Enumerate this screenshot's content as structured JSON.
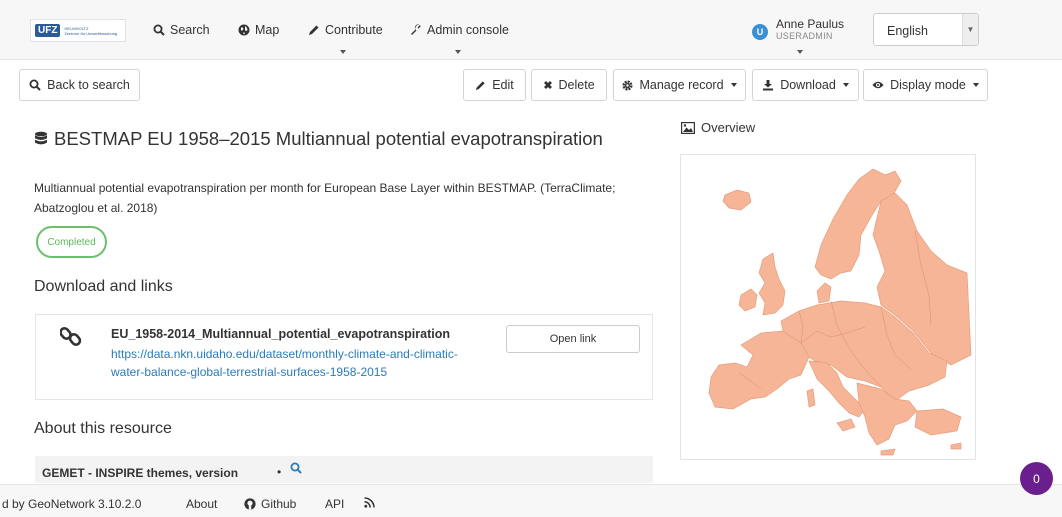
{
  "brand": {
    "logo_abbr": "UFZ",
    "logo_line1": "HELMHOLTZ",
    "logo_line2": "Zentrum für Umweltforschung"
  },
  "nav": {
    "search": "Search",
    "map": "Map",
    "contribute": "Contribute",
    "admin": "Admin console"
  },
  "user": {
    "name": "Anne Paulus",
    "role": "USERADMIN",
    "initial": "U"
  },
  "language": {
    "selected": "English"
  },
  "toolbar": {
    "back": "Back to search",
    "edit": "Edit",
    "delete": "Delete",
    "manage": "Manage record",
    "download": "Download",
    "display": "Display mode"
  },
  "record": {
    "title": "BESTMAP EU 1958–2015 Multiannual potential evapotranspiration",
    "abstract": "Multiannual potential evapotranspiration per month for European Base Layer within BESTMAP. (TerraClimate; Abatzoglou et al. 2018)",
    "status": "Completed"
  },
  "links_section": {
    "heading": "Download and links",
    "item_title": "EU_1958-2014_Multiannual_potential_evapotranspiration",
    "item_url": "https://data.nkn.uidaho.edu/dataset/monthly-climate-and-climatic-water-balance-global-terrestrial-surfaces-1958-2015",
    "open_label": "Open link"
  },
  "about_section": {
    "heading": "About this resource",
    "gemet_label": "GEMET - INSPIRE themes, version",
    "bullet": "•"
  },
  "overview": {
    "heading": "Overview",
    "map_color": "#f5b596"
  },
  "footer": {
    "powered": "d by GeoNetwork 3.10.2.0",
    "about": "About",
    "github": "Github",
    "api": "API"
  },
  "notification": {
    "count": "0"
  }
}
